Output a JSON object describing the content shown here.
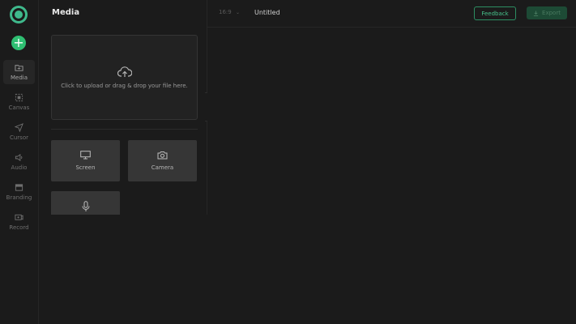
{
  "sidebar": {
    "logo": "app-logo",
    "add_button": "+",
    "items": [
      {
        "label": "Media",
        "icon": "folder-icon"
      },
      {
        "label": "Canvas",
        "icon": "canvas-icon"
      },
      {
        "label": "Cursor",
        "icon": "cursor-icon"
      },
      {
        "label": "Audio",
        "icon": "speaker-icon"
      },
      {
        "label": "Branding",
        "icon": "branding-icon"
      },
      {
        "label": "Record",
        "icon": "record-icon"
      }
    ]
  },
  "panel": {
    "title": "Media",
    "upload_hint": "Click to upload or drag & drop your file here.",
    "tiles": [
      {
        "label": "Screen",
        "icon": "monitor-icon"
      },
      {
        "label": "Camera",
        "icon": "camera-icon"
      },
      {
        "label": "",
        "icon": "microphone-icon"
      }
    ]
  },
  "topbar": {
    "aspect_ratio": "16:9",
    "document_title": "Untitled",
    "feedback_label": "Feedback",
    "export_label": "Export"
  },
  "colors": {
    "accent": "#2fbf72",
    "background": "#1b1b1b",
    "panel": "#222222",
    "tile": "#363636"
  }
}
